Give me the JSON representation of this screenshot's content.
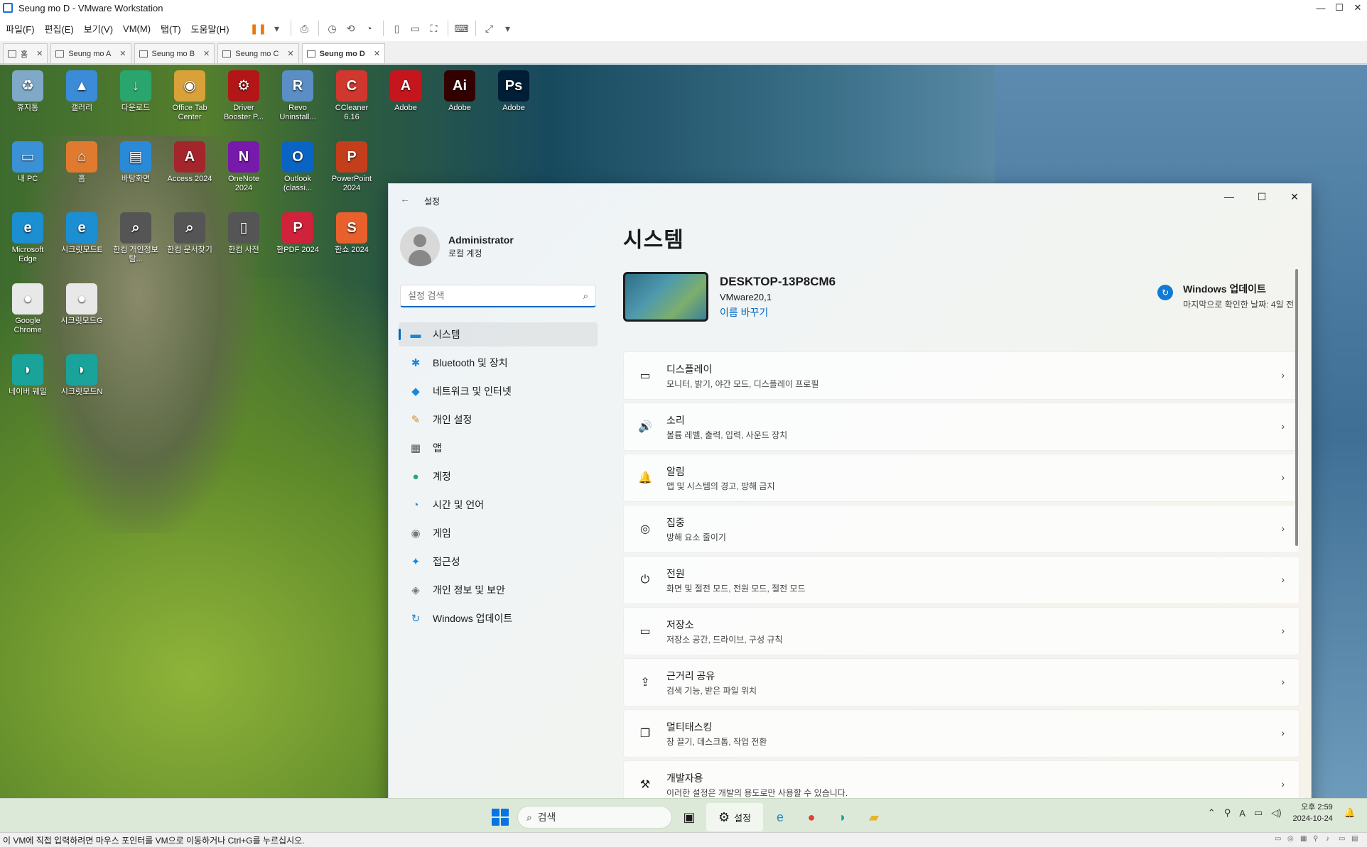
{
  "window": {
    "title": "Seung mo D - VMware Workstation"
  },
  "menu": [
    "파일(F)",
    "편집(E)",
    "보기(V)",
    "VM(M)",
    "탭(T)",
    "도움말(H)"
  ],
  "tabs": [
    {
      "label": "홈"
    },
    {
      "label": "Seung mo A"
    },
    {
      "label": "Seung mo B"
    },
    {
      "label": "Seung mo C"
    },
    {
      "label": "Seung mo D"
    }
  ],
  "desktop_icons": [
    {
      "label": "휴지통",
      "icon": "recycle-bin-icon",
      "color": "#7fa9c7",
      "glyph": "♻"
    },
    {
      "label": "갤러리",
      "icon": "gallery-icon",
      "color": "#3b8bd8",
      "glyph": "▲"
    },
    {
      "label": "다운로드",
      "icon": "downloads-icon",
      "color": "#2aa56e",
      "glyph": "↓"
    },
    {
      "label": "Office Tab Center",
      "icon": "office-tab-icon",
      "color": "#d9a13a",
      "glyph": "◉"
    },
    {
      "label": "Driver Booster P...",
      "icon": "driver-booster-icon",
      "color": "#b31616",
      "glyph": "⚙"
    },
    {
      "label": "Revo Uninstall...",
      "icon": "revo-uninstaller-icon",
      "color": "#5a8ec4",
      "glyph": "R"
    },
    {
      "label": "CCleaner 6.16",
      "icon": "ccleaner-icon",
      "color": "#d0372e",
      "glyph": "C"
    },
    {
      "label": "Adobe",
      "icon": "adobe-acrobat-icon",
      "color": "#c5161d",
      "glyph": "A"
    },
    {
      "label": "Adobe",
      "icon": "adobe-illustrator-icon",
      "color": "#330000",
      "glyph": "Ai"
    },
    {
      "label": "Adobe",
      "icon": "adobe-photoshop-icon",
      "color": "#001e36",
      "glyph": "Ps"
    },
    {
      "label": "내 PC",
      "icon": "this-pc-icon",
      "color": "#3a91d6",
      "glyph": "▭"
    },
    {
      "label": "홈",
      "icon": "home-icon",
      "color": "#e07a2e",
      "glyph": "⌂"
    },
    {
      "label": "바탕화면",
      "icon": "desktop-folder-icon",
      "color": "#2b8ad8",
      "glyph": "▤"
    },
    {
      "label": "Access 2024",
      "icon": "access-icon",
      "color": "#a4262c",
      "glyph": "A"
    },
    {
      "label": "OneNote 2024",
      "icon": "onenote-icon",
      "color": "#7719aa",
      "glyph": "N"
    },
    {
      "label": "Outlook (classi...",
      "icon": "outlook-icon",
      "color": "#0a64c4",
      "glyph": "O"
    },
    {
      "label": "PowerPoint 2024",
      "icon": "powerpoint-icon",
      "color": "#c43e1c",
      "glyph": "P"
    },
    {
      "label": "Microsoft Edge",
      "icon": "edge-icon",
      "color": "#1b8fd1",
      "glyph": "e"
    },
    {
      "label": "시크릿모드E",
      "icon": "edge-private-icon",
      "color": "#1b8fd1",
      "glyph": "e"
    },
    {
      "label": "한컴 개인정보탐...",
      "icon": "hancom-privacy-icon",
      "color": "#555555",
      "glyph": "⌕"
    },
    {
      "label": "한컴 문서찾기",
      "icon": "hancom-search-icon",
      "color": "#555555",
      "glyph": "⌕"
    },
    {
      "label": "한컴 사전",
      "icon": "hancom-dictionary-icon",
      "color": "#555555",
      "glyph": "▯"
    },
    {
      "label": "한PDF 2024",
      "icon": "hanpdf-icon",
      "color": "#d0223a",
      "glyph": "P"
    },
    {
      "label": "한쇼 2024",
      "icon": "hanshow-icon",
      "color": "#e8602c",
      "glyph": "S"
    },
    {
      "label": "Google Chrome",
      "icon": "chrome-icon",
      "color": "#e8e8e8",
      "glyph": "●"
    },
    {
      "label": "시크릿모드G",
      "icon": "chrome-private-icon",
      "color": "#e8e8e8",
      "glyph": "●"
    },
    {
      "label": "네이버 웨일",
      "icon": "whale-icon",
      "color": "#1aa39a",
      "glyph": "◗"
    },
    {
      "label": "시크릿모드N",
      "icon": "whale-private-icon",
      "color": "#1aa39a",
      "glyph": "◗"
    }
  ],
  "settings": {
    "title": "설정",
    "user": {
      "name": "Administrator",
      "type": "로컬 계정"
    },
    "search_placeholder": "설정 검색",
    "nav": [
      {
        "label": "시스템",
        "icon": "system-icon",
        "glyph": "▬",
        "color": "#1a86d9"
      },
      {
        "label": "Bluetooth 및 장치",
        "icon": "bluetooth-icon",
        "glyph": "✱",
        "color": "#1a86d9"
      },
      {
        "label": "네트워크 및 인터넷",
        "icon": "network-icon",
        "glyph": "◆",
        "color": "#1a86d9"
      },
      {
        "label": "개인 설정",
        "icon": "personalize-icon",
        "glyph": "✎",
        "color": "#d08a2a"
      },
      {
        "label": "앱",
        "icon": "apps-icon",
        "glyph": "▦",
        "color": "#555555"
      },
      {
        "label": "계정",
        "icon": "accounts-icon",
        "glyph": "●",
        "color": "#2aa56e"
      },
      {
        "label": "시간 및 언어",
        "icon": "time-language-icon",
        "glyph": "◔",
        "color": "#1a86d9"
      },
      {
        "label": "게임",
        "icon": "gaming-icon",
        "glyph": "◉",
        "color": "#777777"
      },
      {
        "label": "접근성",
        "icon": "accessibility-icon",
        "glyph": "✦",
        "color": "#1a86d9"
      },
      {
        "label": "개인 정보 및 보안",
        "icon": "privacy-shield-icon",
        "glyph": "◈",
        "color": "#777777"
      },
      {
        "label": "Windows 업데이트",
        "icon": "windows-update-icon",
        "glyph": "↻",
        "color": "#1a86d9"
      }
    ],
    "page_title": "시스템",
    "device": {
      "name": "DESKTOP-13P8CM6",
      "model": "VMware20,1",
      "rename": "이름 바꾸기"
    },
    "update": {
      "title": "Windows 업데이트",
      "subtitle": "마지막으로 확인한 날짜: 4일 전"
    },
    "cards": [
      {
        "title": "디스플레이",
        "subtitle": "모니터, 밝기, 야간 모드, 디스플레이 프로필",
        "icon": "display-icon",
        "glyph": "▭"
      },
      {
        "title": "소리",
        "subtitle": "볼륨 레벨, 출력, 입력, 사운드 장치",
        "icon": "sound-icon",
        "glyph": "🔊"
      },
      {
        "title": "알림",
        "subtitle": "앱 및 시스템의 경고, 방해 금지",
        "icon": "notification-bell-icon",
        "glyph": "🔔"
      },
      {
        "title": "집중",
        "subtitle": "방해 요소 줄이기",
        "icon": "focus-icon",
        "glyph": "◎"
      },
      {
        "title": "전원",
        "subtitle": "화면 및 절전 모드, 전원 모드, 절전 모드",
        "icon": "power-icon",
        "glyph": "⏻"
      },
      {
        "title": "저장소",
        "subtitle": "저장소 공간, 드라이브, 구성 규칙",
        "icon": "storage-icon",
        "glyph": "▭"
      },
      {
        "title": "근거리 공유",
        "subtitle": "검색 기능, 받은 파일 위치",
        "icon": "nearby-share-icon",
        "glyph": "⇪"
      },
      {
        "title": "멀티태스킹",
        "subtitle": "창 끌기, 데스크톱, 작업 전환",
        "icon": "multitasking-icon",
        "glyph": "❐"
      },
      {
        "title": "개발자용",
        "subtitle": "이러한 설정은 개발의 용도로만 사용할 수 있습니다.",
        "icon": "developer-icon",
        "glyph": "⚒"
      }
    ]
  },
  "taskbar": {
    "search_placeholder": "검색",
    "active_app_label": "설정",
    "clock_time": "오후 2:59",
    "clock_date": "2024-10-24"
  },
  "statusbar": {
    "text": "이 VM에 직접 입력하려면 마우스 포인터를 VM으로 이동하거나 Ctrl+G를 누르십시오."
  },
  "colors": {
    "accent": "#0067c0",
    "vmware_pause": "#e8770e"
  }
}
